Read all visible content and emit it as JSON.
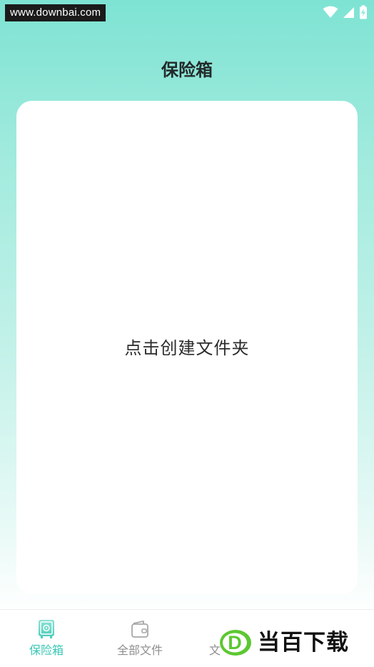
{
  "watermark": {
    "url": "www.downbai.com"
  },
  "header": {
    "title": "保险箱"
  },
  "main": {
    "create_folder_label": "点击创建文件夹"
  },
  "bottom_nav": {
    "items": [
      {
        "label": "保险箱",
        "icon": "safe-icon",
        "active": true
      },
      {
        "label": "全部文件",
        "icon": "wallet-icon",
        "active": false
      },
      {
        "label": "文",
        "icon": "file-icon",
        "active": false
      }
    ]
  },
  "brand_watermark": {
    "letter": "D",
    "text": "当百下载"
  },
  "colors": {
    "accent": "#38c7b4",
    "gradient_top": "#7ee3d3",
    "title_text": "#222a2a",
    "inactive_nav": "#8e8e8e",
    "brand_green": "#5cc832"
  }
}
